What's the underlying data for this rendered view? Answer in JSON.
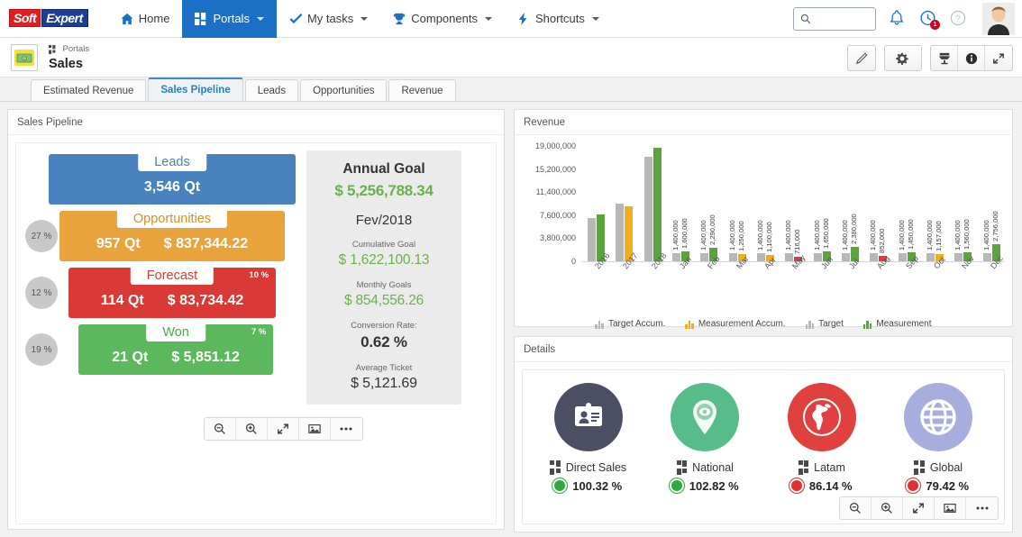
{
  "topnav": {
    "logo": {
      "part1": "Soft",
      "part2": "Expert"
    },
    "items": [
      {
        "label": "Home",
        "icon": "home-icon",
        "has_caret": false,
        "active": false
      },
      {
        "label": "Portals",
        "icon": "grid-icon",
        "has_caret": true,
        "active": true
      },
      {
        "label": "My tasks",
        "icon": "check-icon",
        "has_caret": true,
        "active": false
      },
      {
        "label": "Components",
        "icon": "trophy-icon",
        "has_caret": true,
        "active": false
      },
      {
        "label": "Shortcuts",
        "icon": "bolt-icon",
        "has_caret": true,
        "active": false
      }
    ],
    "search": {
      "value": "",
      "placeholder": ""
    },
    "notification_badge": "1"
  },
  "pagehead": {
    "breadcrumb": "Portals",
    "title": "Sales",
    "tools": [
      "edit-pencil-button",
      "settings-gear-button",
      "print-button",
      "info-button",
      "collapse-button"
    ]
  },
  "tabs": [
    {
      "label": "Estimated Revenue",
      "active": false
    },
    {
      "label": "Sales Pipeline",
      "active": true
    },
    {
      "label": "Leads",
      "active": false
    },
    {
      "label": "Opportunities",
      "active": false
    },
    {
      "label": "Revenue",
      "active": false
    }
  ],
  "sales_pipeline": {
    "panel_title": "Sales Pipeline",
    "funnel": [
      {
        "name": "Leads",
        "qty": "3,546 Qt",
        "amount": "",
        "pct_left": "",
        "pct_right": "",
        "color": "#4a81bf"
      },
      {
        "name": "Opportunities",
        "qty": "957 Qt",
        "amount": "$ 837,344.22",
        "pct_left": "27 %",
        "pct_right": "",
        "color": "#e8a33d"
      },
      {
        "name": "Forecast",
        "qty": "114 Qt",
        "amount": "$ 83,734.42",
        "pct_left": "12 %",
        "pct_right": "10 %",
        "color": "#d93a35"
      },
      {
        "name": "Won",
        "qty": "21 Qt",
        "amount": "$ 5,851.12",
        "pct_left": "19 %",
        "pct_right": "7 %",
        "color": "#5cb85c"
      }
    ],
    "goal": {
      "heading": "Annual Goal",
      "annual_value": "$ 5,256,788.34",
      "period": "Fev/2018",
      "cumulative_label": "Cumulative Goal",
      "cumulative_value": "$ 1,622,100.13",
      "monthly_label": "Monthly Goals",
      "monthly_value": "$ 854,556.26",
      "conversion_label": "Conversion Rate:",
      "conversion_value": "0.62 %",
      "ticket_label": "Average Ticket",
      "ticket_value": "$ 5,121.69"
    },
    "toolbar": [
      "zoom-out-icon",
      "zoom-in-icon",
      "collapse-icon",
      "image-icon",
      "more-icon"
    ]
  },
  "revenue": {
    "panel_title": "Revenue"
  },
  "details": {
    "panel_title": "Details",
    "items": [
      {
        "name": "Direct Sales",
        "value": "100.32 %",
        "status": "green",
        "icon": "id-card-icon",
        "circle_color": "#4c4f63"
      },
      {
        "name": "National",
        "value": "102.82 %",
        "status": "green",
        "icon": "map-pin-icon",
        "circle_color": "#57bb8a"
      },
      {
        "name": "Latam",
        "value": "86.14 %",
        "status": "red",
        "icon": "americas-icon",
        "circle_color": "#e0413f"
      },
      {
        "name": "Global",
        "value": "79.42 %",
        "status": "red",
        "icon": "globe-icon",
        "circle_color": "#a7aedd"
      }
    ],
    "toolbar": [
      "zoom-out-icon",
      "zoom-in-icon",
      "collapse-icon",
      "image-icon",
      "more-icon"
    ]
  },
  "chart_data": {
    "type": "bar",
    "title": "Revenue",
    "xlabel": "",
    "ylabel": "",
    "ylim": [
      0,
      19000000
    ],
    "yticks": [
      0,
      3800000,
      7600000,
      11400000,
      15200000,
      19000000
    ],
    "ytick_labels": [
      "0",
      "3,800,000",
      "7,600,000",
      "11,400,000",
      "15,200,000",
      "19,000,000"
    ],
    "grid": false,
    "legend_position": "bottom",
    "legend": [
      {
        "name": "Target Accum.",
        "color": "#b7b7b7"
      },
      {
        "name": "Measurement Accum.",
        "color": "#f0ad22"
      },
      {
        "name": "Target",
        "color": "#b7b7b7"
      },
      {
        "name": "Measurement",
        "color": "#5ca340"
      }
    ],
    "categories": [
      "2016",
      "2017",
      "2018",
      "Jan",
      "Feb",
      "Mar",
      "Apr",
      "May",
      "Jun",
      "Jul",
      "Aug",
      "Sep",
      "Oct",
      "Nov",
      "Dec"
    ],
    "series": [
      {
        "name": "Target",
        "values": [
          7200000,
          9500000,
          17200000,
          1400000,
          1400000,
          1400000,
          1400000,
          1400000,
          1400000,
          1400000,
          1400000,
          1400000,
          1400000,
          1400000,
          1400000
        ]
      },
      {
        "name": "Measurement",
        "values": [
          7700000,
          9100000,
          18700000,
          1600000,
          2290000,
          1250000,
          1100000,
          716000,
          1650000,
          2380000,
          852000,
          1450000,
          1157000,
          1560000,
          2756000
        ]
      }
    ],
    "measurement_status": [
      "green",
      "orange",
      "green",
      "green",
      "green",
      "orange",
      "orange",
      "red",
      "green",
      "green",
      "red",
      "green",
      "orange",
      "green",
      "green"
    ],
    "data_labels": [
      {
        "category": "Jan",
        "target": "1,400,000",
        "measurement": "1,600,000"
      },
      {
        "category": "Feb",
        "target": "1,400,000",
        "measurement": "2,290,000"
      },
      {
        "category": "Mar",
        "target": "1,400,000",
        "measurement": "1,250,000"
      },
      {
        "category": "Apr",
        "target": "1,400,000",
        "measurement": "1,100,000"
      },
      {
        "category": "May",
        "target": "1,400,000",
        "measurement": "716,000"
      },
      {
        "category": "Jun",
        "target": "1,400,000",
        "measurement": "1,650,000"
      },
      {
        "category": "Jul",
        "target": "1,400,000",
        "measurement": "2,380,000"
      },
      {
        "category": "Aug",
        "target": "1,400,000",
        "measurement": "852,000"
      },
      {
        "category": "Sep",
        "target": "1,400,000",
        "measurement": "1,450,000"
      },
      {
        "category": "Oct",
        "target": "1,400,000",
        "measurement": "1,157,000"
      },
      {
        "category": "Nov",
        "target": "1,400,000",
        "measurement": "1,560,000"
      },
      {
        "category": "Dec",
        "target": "1,400,000",
        "measurement": "2,756,000"
      }
    ]
  }
}
